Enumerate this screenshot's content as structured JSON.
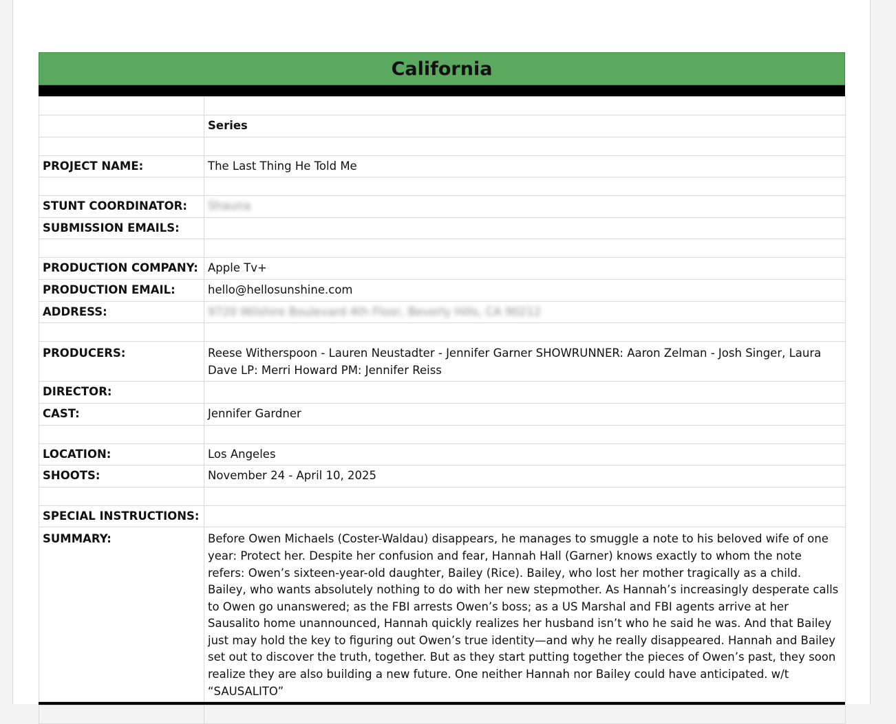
{
  "sheet": {
    "title": "California",
    "type_value": "Series",
    "rows": {
      "project_name": {
        "label": "PROJECT NAME:",
        "value": "The Last Thing He Told Me"
      },
      "stunt_coordinator": {
        "label": "STUNT COORDINATOR:",
        "value": "Shauna"
      },
      "submission_emails": {
        "label": "SUBMISSION EMAILS:",
        "value": ""
      },
      "production_company": {
        "label": "PRODUCTION COMPANY:",
        "value": "Apple Tv+"
      },
      "production_email": {
        "label": "PRODUCTION EMAIL:",
        "value": "hello@hellosunshine.com"
      },
      "address": {
        "label": "ADDRESS:",
        "value": "9720 Wilshire Boulevard 4th Floor, Beverly Hills, CA 90212"
      },
      "producers": {
        "label": "PRODUCERS:",
        "value": "Reese Witherspoon - Lauren Neustadter - Jennifer Garner SHOWRUNNER: Aaron Zelman - Josh Singer, Laura Dave LP: Merri Howard PM: Jennifer Reiss"
      },
      "director": {
        "label": "DIRECTOR:",
        "value": ""
      },
      "cast": {
        "label": "CAST:",
        "value": "Jennifer Gardner"
      },
      "location": {
        "label": "LOCATION:",
        "value": "Los Angeles"
      },
      "shoots": {
        "label": "SHOOTS:",
        "value": "November 24 - April 10, 2025"
      },
      "special_instructions": {
        "label": "SPECIAL INSTRUCTIONS:",
        "value": ""
      },
      "summary": {
        "label": "SUMMARY:",
        "value": "Before Owen Michaels (Coster-Waldau) disappears, he manages to smuggle a note to his beloved wife of one year: Protect her. Despite her confusion and fear, Hannah Hall (Garner) knows exactly to whom the note refers: Owen’s sixteen-year-old daughter, Bailey (Rice). Bailey, who lost her mother tragically as a child. Bailey, who wants absolutely nothing to do with her new stepmother. As Hannah’s increasingly desperate calls to Owen go unanswered; as the FBI arrests Owen’s boss; as a US Marshal and FBI agents arrive at her Sausalito home unannounced, Hannah quickly realizes her husband isn’t who he said he was. And that Bailey just may hold the key to figuring out Owen’s true identity—and why he really disappeared. Hannah and Bailey set out to discover the truth, together. But as they start putting together the pieces of Owen’s past, they soon realize they are also building a new future. One neither Hannah nor Bailey could have anticipated. w/t “SAUSALITO”"
      }
    }
  },
  "colors": {
    "header_green": "#5aa95e",
    "border_gray": "#d9d9d9"
  }
}
